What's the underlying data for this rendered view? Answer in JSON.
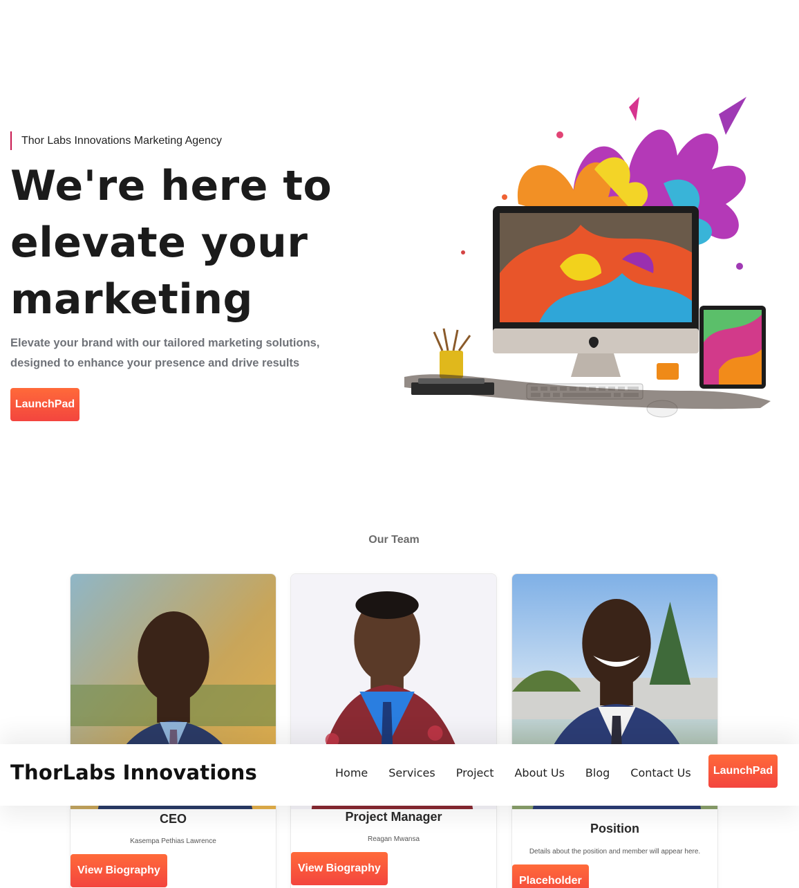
{
  "hero": {
    "eyebrow": "Thor Labs Innovations Marketing Agency",
    "headline": "We're here to elevate your marketing",
    "subtext": "Elevate your brand with our tailored marketing solutions, designed to enhance your presence and drive results",
    "cta_label": "LaunchPad"
  },
  "team": {
    "heading": "Our Team",
    "members": [
      {
        "role": "CEO",
        "name": "Kasempa Pethias Lawrence",
        "button": "View Biography"
      },
      {
        "role": "Project Manager",
        "name": "Reagan Mwansa",
        "button": "View Biography"
      },
      {
        "role": "Position",
        "name": "Details about the position and member will appear here.",
        "button": "Placeholder"
      }
    ]
  },
  "navbar": {
    "brand": "ThorLabs Innovations",
    "links": [
      "Home",
      "Services",
      "Project",
      "About Us",
      "Blog",
      "Contact Us"
    ],
    "cta_label": "LaunchPad"
  },
  "colors": {
    "accent": "#f3453e",
    "eyebrow_bar": "#c8174f",
    "subtext": "#6f7278"
  }
}
